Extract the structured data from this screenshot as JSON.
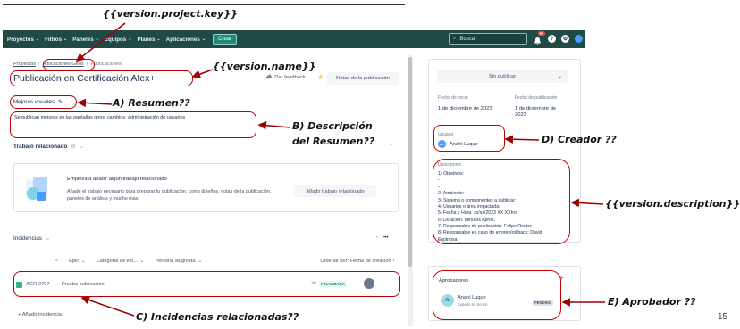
{
  "annotations": {
    "key": "{{version.project.key}}",
    "name": "{{version.name}}",
    "summary": "A) Resumen??",
    "description_1": "B)  Descripción",
    "description_2": "del Resumen??",
    "creator": "D) Creador ??",
    "version_description": "{{version.description}}",
    "approver": "E) Aprobador ??",
    "issues": "C) Incidencias relacionadas??"
  },
  "nav": {
    "items": [
      "Proyectos",
      "Filtros",
      "Paneles",
      "Equipos",
      "Planes",
      "Aplicaciones"
    ],
    "create": "Crear",
    "search_placeholder": "Buscar",
    "notif_count": "9+"
  },
  "breadcrumb": [
    "Proyectos",
    "Aplicaciones Giros",
    "Publicaciones"
  ],
  "page": {
    "title": "Publicación en Certificación Afex+",
    "feedback": "Dar feedback",
    "notes": "Notas de la publicación",
    "summary_label": "Mejoras visuales",
    "description": "Se publican mejoras en las pantallas giros: cambios, administración de usuarios",
    "related_work": "Trabajo relacionado",
    "empty_title": "Empieza a añadir algún trabajo relacionado",
    "empty_body": "Añade el trabajo necesario para preparar tu publicación, como diseños, notas de la publicación, paneles de análisis y mucho más.",
    "add_work": "Añadir trabajo relacionado",
    "issues_title": "Incidencias",
    "filters": [
      "Epic",
      "Categoría de est...",
      "Persona asignada"
    ],
    "sort": "Ordenar por: Fecha de creación",
    "issue": {
      "key": "AGR-2797",
      "summary": "Prueba publicacion",
      "status": "FINALIZADA"
    },
    "add_issue": "Añadir incidencia"
  },
  "side": {
    "publish": "Sin publicar",
    "start_label": "Fecha de inicio",
    "start_value": "1 de diciembre de 2023",
    "pub_label": "Fecha de publicación",
    "pub_value_1": "1 de diciembre de",
    "pub_value_2": "2023",
    "user_label": "Usuario",
    "user_name": "Anahí Luque",
    "user_initials": "AL",
    "desc_label": "Descripción",
    "desc_lines": [
      "1) Objetivos:",
      "-",
      "-",
      "2) Ambiente:",
      "3) Sistema o componentes a publicar:",
      "4) Usuarios o área impactada:",
      "5) Fecha y Hora: xx/xx/2023 XX:XXhrs",
      "6) Duración: Minutos Aprox.",
      "7) Responsable de publicación: Felipe Reuter",
      "8) Responsable en caso de errores/rollback: David",
      "Espinosa"
    ],
    "approvers_label": "Aprobadores",
    "approver_name": "Anahí Luque",
    "approver_role": "Experto en Scrum",
    "approver_status": "PENDING"
  },
  "page_number": "15"
}
